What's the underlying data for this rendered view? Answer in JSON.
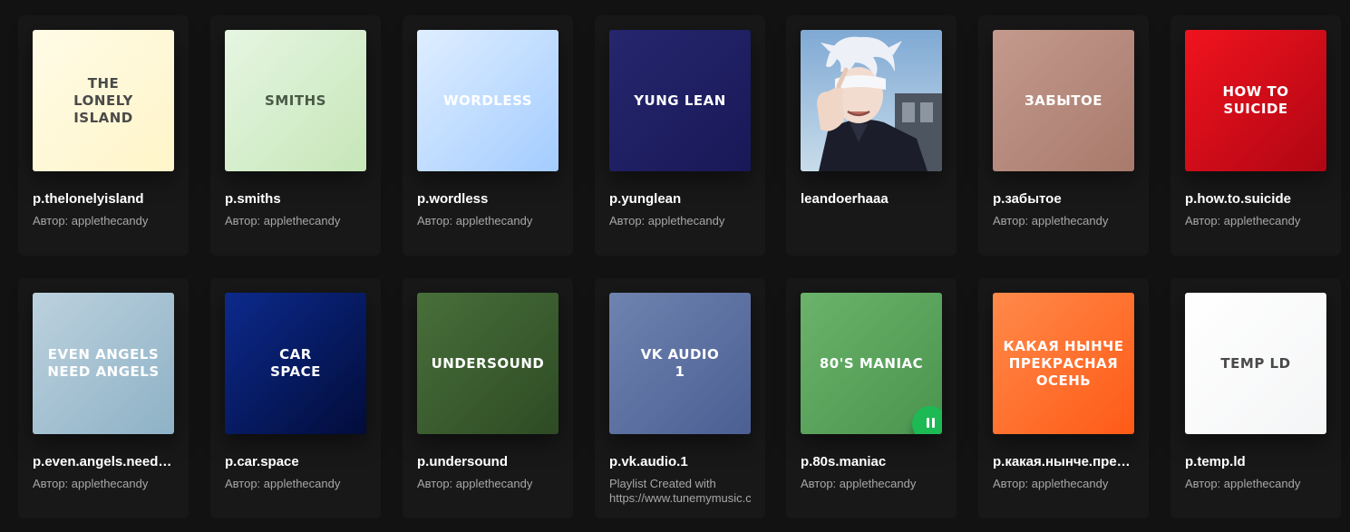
{
  "cards": [
    {
      "cover_text": "THE\nLONELY\nISLAND",
      "title": "p.thelonelyisland",
      "subtitle": "Автор: applethecandy",
      "cover_bg": "linear-gradient(135deg,#fffbe6,#fff5c9)",
      "cover_fg": "#4a4a4a"
    },
    {
      "cover_text": "SMITHS",
      "title": "p.smiths",
      "subtitle": "Автор: applethecandy",
      "cover_bg": "linear-gradient(135deg,#e6f6e2,#c6e6b8)",
      "cover_fg": "#4a5a48"
    },
    {
      "cover_text": "WORDLESS",
      "title": "p.wordless",
      "subtitle": "Автор: applethecandy",
      "cover_bg": "linear-gradient(135deg,#dfeeff,#a3ccff)",
      "cover_fg": "#ffffff"
    },
    {
      "cover_text": "YUNG LEAN",
      "title": "p.yunglean",
      "subtitle": "Автор: applethecandy",
      "cover_bg": "linear-gradient(135deg,#26266e,#181858)",
      "cover_fg": "#ffffff"
    },
    {
      "cover_text": "",
      "title": "leandoerhaaa",
      "subtitle": "",
      "cover_bg": "#9fc0dc",
      "cover_fg": "#ffffff",
      "image": "anime-character-cover"
    },
    {
      "cover_text": "ЗАБЫТОЕ",
      "title": "p.забытое",
      "subtitle": "Автор: applethecandy",
      "cover_bg": "linear-gradient(135deg,#c39a8d,#a87a6c)",
      "cover_fg": "#ffffff"
    },
    {
      "cover_text": "HOW TO\nSUICIDE",
      "title": "p.how.to.suicide",
      "subtitle": "Автор: applethecandy",
      "cover_bg": "linear-gradient(135deg,#f0131e,#b00613)",
      "cover_fg": "#ffffff"
    },
    {
      "cover_text": "EVEN ANGELS\nNEED ANGELS",
      "title": "p.even.angels.need.angels",
      "subtitle": "Автор: applethecandy",
      "cover_bg": "linear-gradient(135deg,#bcd1de,#8eb2c6)",
      "cover_fg": "#ffffff"
    },
    {
      "cover_text": "CAR\nSPACE",
      "title": "p.car.space",
      "subtitle": "Автор: applethecandy",
      "cover_bg": "linear-gradient(135deg,#0c2a8c,#020c3a)",
      "cover_fg": "#ffffff"
    },
    {
      "cover_text": "UNDERSOUND",
      "title": "p.undersound",
      "subtitle": "Автор: applethecandy",
      "cover_bg": "linear-gradient(135deg,#486f3a,#2e4b24)",
      "cover_fg": "#ffffff"
    },
    {
      "cover_text": "VK AUDIO\n1",
      "title": "p.vk.audio.1",
      "subtitle": "Playlist Created with https://www.tunemymusic.com",
      "subtitle_multiline": true,
      "cover_bg": "linear-gradient(135deg,#6f83b0,#4b5f93)",
      "cover_fg": "#ffffff"
    },
    {
      "cover_text": "80'S MANIAC",
      "title": "p.80s.maniac",
      "subtitle": "Автор: applethecandy",
      "cover_bg": "linear-gradient(135deg,#6bb36a,#4a944f)",
      "cover_fg": "#ffffff",
      "playing": true
    },
    {
      "cover_text": "КАКАЯ НЫНЧЕ\nПРЕКРАСНАЯ\nОСЕНЬ",
      "title": "p.какая.нынче.прекрасная.осень",
      "subtitle": "Автор: applethecandy",
      "cover_bg": "linear-gradient(135deg,#ff8a4a,#ff5a16)",
      "cover_fg": "#ffffff"
    },
    {
      "cover_text": "TEMP LD",
      "title": "p.temp.ld",
      "subtitle": "Автор: applethecandy",
      "cover_bg": "linear-gradient(135deg,#ffffff,#f4f5f6)",
      "cover_fg": "#4a4a4a"
    }
  ],
  "colors": {
    "background": "#121212",
    "card": "#181818",
    "accent": "#1db954"
  },
  "icons": {
    "play_state": "pause-icon"
  }
}
